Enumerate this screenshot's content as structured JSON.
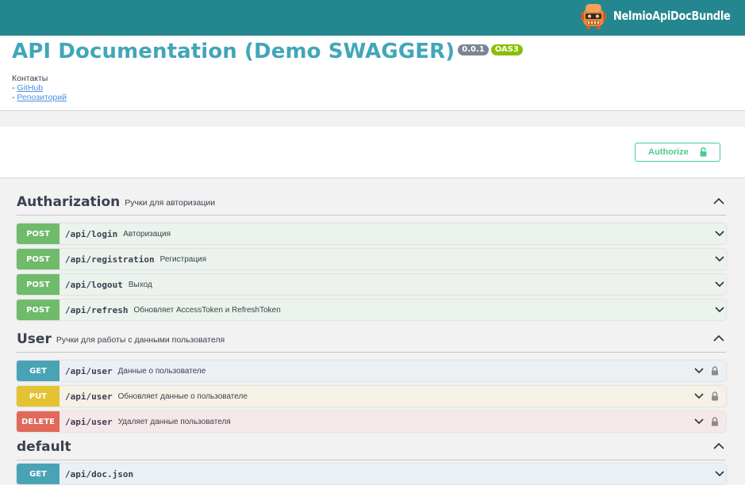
{
  "topbar": {
    "brand_name": "NelmioApiDocBundle",
    "brand_logo_icon": "nelmio-robot-icon",
    "background_color": "#24868e"
  },
  "info": {
    "title": "API Documentation (Demo SWAGGER)",
    "version_badge": "0.0.1",
    "oas_badge": "OAS3",
    "contacts_label": "Контакты",
    "links": [
      {
        "prefix": "- ",
        "label": "GitHub"
      },
      {
        "prefix": "- ",
        "label": "Репозиторий"
      }
    ]
  },
  "auth": {
    "authorize_label": "Authorize",
    "lock_icon": "lock-open-icon",
    "color": "#49cc90"
  },
  "tags": [
    {
      "name": "Autharization",
      "description": "Ручки для авторизации",
      "toggle_icon": "chevron-up-icon",
      "operations": [
        {
          "method": "POST",
          "path": "/api/login",
          "summary": "Авторизация",
          "locked": false
        },
        {
          "method": "POST",
          "path": "/api/registration",
          "summary": "Регистрация",
          "locked": false
        },
        {
          "method": "POST",
          "path": "/api/logout",
          "summary": "Выход",
          "locked": false
        },
        {
          "method": "POST",
          "path": "/api/refresh",
          "summary": "Обновляет AccessToken и RefreshToken",
          "locked": false
        }
      ]
    },
    {
      "name": "User",
      "description": "Ручки для работы с данными пользователя",
      "toggle_icon": "chevron-up-icon",
      "operations": [
        {
          "method": "GET",
          "path": "/api/user",
          "summary": "Данные о пользователе",
          "locked": true
        },
        {
          "method": "PUT",
          "path": "/api/user",
          "summary": "Обновляет данные о пользователе",
          "locked": true
        },
        {
          "method": "DELETE",
          "path": "/api/user",
          "summary": "Удаляет данные пользователя",
          "locked": true
        }
      ]
    },
    {
      "name": "default",
      "description": "",
      "toggle_icon": "chevron-up-icon",
      "operations": [
        {
          "method": "GET",
          "path": "/api/doc.json",
          "summary": "",
          "locked": false
        }
      ]
    }
  ],
  "method_colors": {
    "POST": "#6fba6b",
    "GET": "#49a3b4",
    "PUT": "#e4c232",
    "DELETE": "#e06a5a"
  }
}
